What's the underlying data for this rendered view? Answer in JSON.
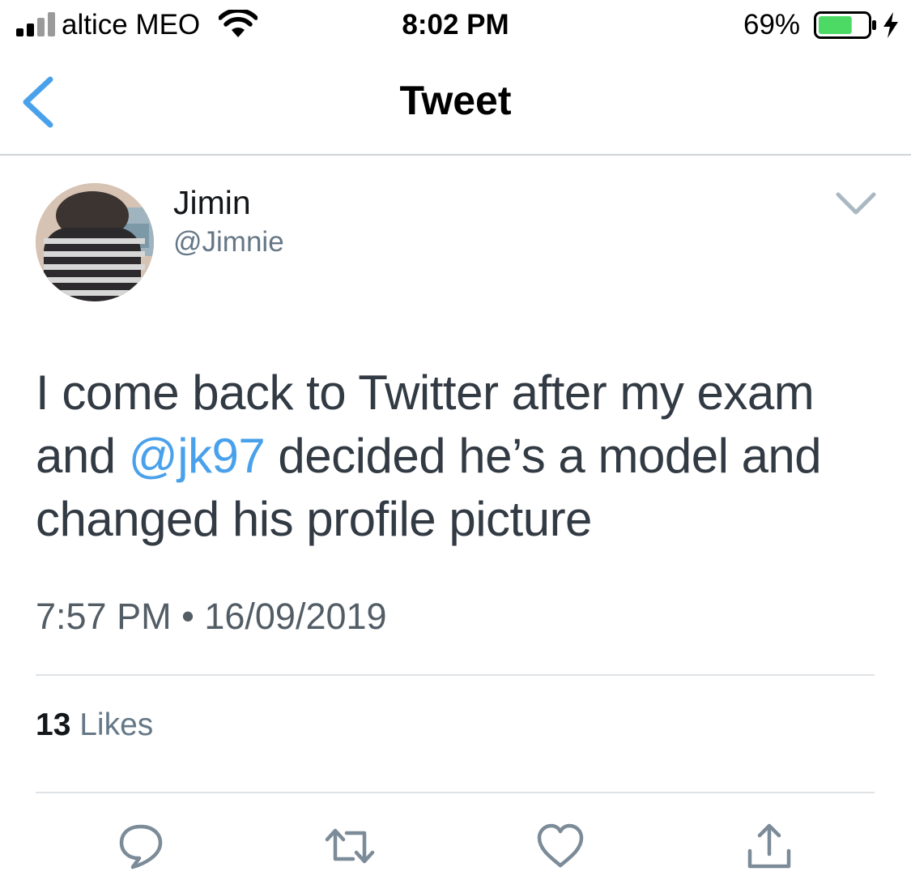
{
  "status_bar": {
    "carrier": "altice MEO",
    "time": "8:02 PM",
    "battery_percent": "69%",
    "battery_level": 0.69,
    "icons": [
      "signal-icon",
      "wifi-icon",
      "battery-icon",
      "charging-bolt-icon"
    ]
  },
  "nav": {
    "back_icon": "chevron-left-icon",
    "title": "Tweet"
  },
  "tweet": {
    "author": {
      "display_name": "Jimin",
      "handle": "@Jimnie"
    },
    "text_lines": [
      {
        "text": "I come back to Twitter after my exam"
      },
      {
        "before": "and ",
        "mention": "@jk97",
        "after": " decided he’s a model and"
      },
      {
        "text": "changed his profile picture"
      }
    ],
    "timestamp": "7:57 PM • 16/09/2019",
    "likes": {
      "count": "13",
      "label": "Likes"
    }
  },
  "actions": [
    {
      "name": "reply",
      "icon": "reply-icon"
    },
    {
      "name": "retweet",
      "icon": "retweet-icon"
    },
    {
      "name": "like",
      "icon": "heart-icon"
    },
    {
      "name": "share",
      "icon": "share-icon"
    }
  ],
  "colors": {
    "accent": "#4AA1EB",
    "text": "#323A43",
    "muted": "#657786",
    "icon": "#7C8B98",
    "battery": "#4CD964",
    "divider": "#DFE3E6"
  }
}
